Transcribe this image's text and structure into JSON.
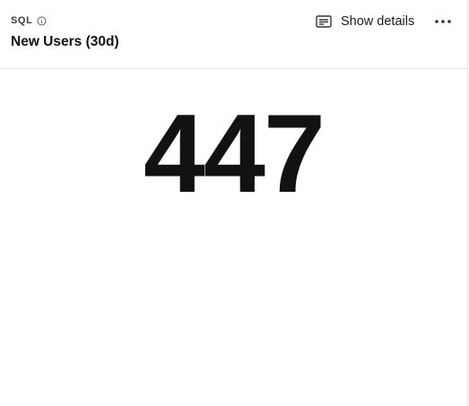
{
  "header": {
    "type_label": "SQL",
    "title": "New Users (30d)",
    "show_details_label": "Show details"
  },
  "icons": {
    "info": "info-icon",
    "details": "details-icon",
    "more": "more-horizontal-icon"
  },
  "metric": {
    "value": "447"
  },
  "colors": {
    "text": "#151515",
    "divider": "#e3e3e3",
    "background": "#ffffff"
  }
}
